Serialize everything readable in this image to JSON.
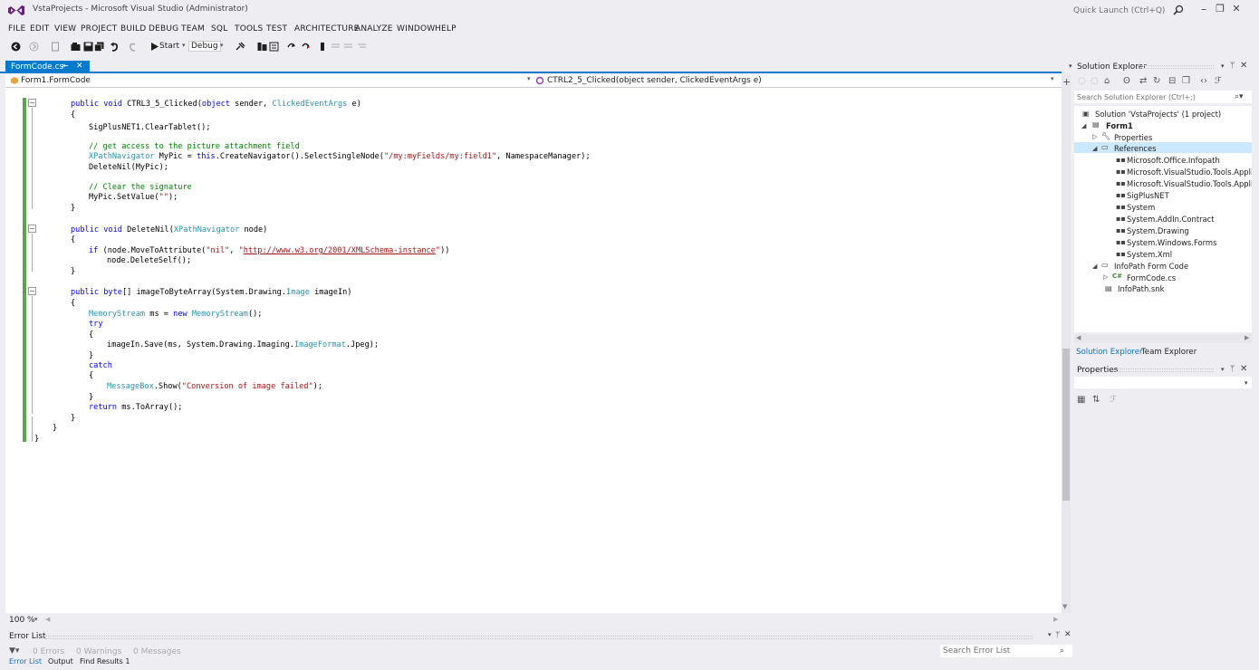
{
  "window": {
    "title": "VstaProjects - Microsoft Visual Studio (Administrator)",
    "quick_launch_placeholder": "Quick Launch (Ctrl+Q)",
    "minimize_glyph": "–",
    "maximize_glyph": "❐",
    "close_glyph": "✕"
  },
  "menu": [
    "FILE",
    "EDIT",
    "VIEW",
    "PROJECT",
    "BUILD",
    "DEBUG",
    "TEAM",
    "SQL",
    "TOOLS",
    "TEST",
    "ARCHITECTURE",
    "ANALYZE",
    "WINDOW",
    "HELP"
  ],
  "toolbar": {
    "start_label": "Start",
    "config_label": "Debug"
  },
  "editor": {
    "tab_label": "FormCode.cs",
    "pin_glyph": "⇤",
    "close_glyph": "✕",
    "nav_class": "Form1.FormCode",
    "nav_member": "CTRL2_5_Clicked(object sender, ClickedEventArgs e)",
    "zoom": "100 %"
  },
  "code_lines": [
    "public void CTRL3_5_Clicked(object sender, ClickedEventArgs e)",
    "{",
    "SigPlusNET1.ClearTablet();",
    "// get access to the picture attachment field",
    "XPathNavigator MyPic = this.CreateNavigator().SelectSingleNode(\"/my:myFields/my:field1\", NamespaceManager);",
    "DeleteNil(MyPic);",
    "// Clear the signature",
    "MyPic.SetValue(\"\");",
    "}",
    "public void DeleteNil(XPathNavigator node)",
    "{",
    "if (node.MoveToAttribute(\"nil\", \"http://www.w3.org/2001/XMLSchema-instance\"))",
    "node.DeleteSelf();",
    "}",
    "public byte[] imageToByteArray(System.Drawing.Image imageIn)",
    "{",
    "MemoryStream ms = new MemoryStream();",
    "try",
    "{",
    "imageIn.Save(ms, System.Drawing.Imaging.ImageFormat.Jpeg);",
    "}",
    "catch",
    "{",
    "MessageBox.Show(\"Conversion of image failed\");",
    "}",
    "return ms.ToArray();",
    "}",
    "}",
    "}"
  ],
  "code_tokens": {
    "kw_public": "public",
    "kw_void": "void",
    "kw_object": "object",
    "kw_this": "this",
    "kw_if": "if",
    "kw_byte": "byte",
    "kw_new": "new",
    "kw_try": "try",
    "kw_catch": "catch",
    "kw_return": "return",
    "t_clicked": "ClickedEventArgs",
    "t_xpath": "XPathNavigator",
    "t_image": "Image",
    "t_memstream": "MemoryStream",
    "t_imageformat": "ImageFormat",
    "t_messagebox": "MessageBox",
    "s_myfield": "\"/my:myFields/my:field1\"",
    "s_empty": "\"\"",
    "s_nil": "\"nil\"",
    "s_url": "http://www.w3.org/2001/XMLSchema-instance",
    "s_conv": "\"Conversion of image failed\"",
    "c_access": "// get access to the picture attachment field",
    "c_clear": "// Clear the signature",
    "p1a": "CTRL3_5_Clicked(",
    "p1b": " sender, ",
    "p1c": " e)",
    "p2": "SigPlusNET1.ClearTablet();",
    "p3a": " MyPic = ",
    "p3b": ".CreateNavigator().SelectSingleNode(",
    "p3c": ", NamespaceManager);",
    "p4": "DeleteNil(MyPic);",
    "p5a": "MyPic.SetValue(",
    "p5b": ");",
    "p6a": "DeleteNil(",
    "p6b": " node)",
    "p7a": " (node.MoveToAttribute(",
    "p7b": ", ",
    "p7q": "\"",
    "p7c": "))",
    "p8": "node.DeleteSelf();",
    "p9a": "[] imageToByteArray(System.Drawing.",
    "p9b": " imageIn)",
    "p10a": " ms = ",
    "p10b": "();",
    "p11a": "imageIn.Save(ms, System.Drawing.Imaging.",
    "p11b": ".Jpeg);",
    "p12a": ".Show(",
    "p12b": ");",
    "p13": " ms.ToArray();",
    "sp": " ",
    "brace_open": "{",
    "brace_close": "}"
  },
  "error_list": {
    "title": "Error List",
    "errors": "0 Errors",
    "warnings": "0 Warnings",
    "messages": "0 Messages",
    "search_placeholder": "Search Error List",
    "tabs": [
      "Error List",
      "Output",
      "Find Results 1"
    ]
  },
  "solution_explorer": {
    "title": "Solution Explorer",
    "search_placeholder": "Search Solution Explorer (Ctrl+;)",
    "tree": [
      {
        "label": "Solution 'VstaProjects' (1 project)"
      },
      {
        "label": "Form1"
      },
      {
        "label": "Properties"
      },
      {
        "label": "References"
      },
      {
        "label": "Microsoft.Office.Infopath"
      },
      {
        "label": "Microsoft.VisualStudio.Tools.Applic"
      },
      {
        "label": "Microsoft.VisualStudio.Tools.Applic"
      },
      {
        "label": "SigPlusNET"
      },
      {
        "label": "System"
      },
      {
        "label": "System.AddIn.Contract"
      },
      {
        "label": "System.Drawing"
      },
      {
        "label": "System.Windows.Forms"
      },
      {
        "label": "System.Xml"
      },
      {
        "label": "InfoPath Form Code"
      },
      {
        "label": "FormCode.cs"
      },
      {
        "label": "InfoPath.snk"
      }
    ],
    "tabs": [
      "Solution Explorer",
      "Team Explorer"
    ]
  },
  "properties": {
    "title": "Properties"
  },
  "colors": {
    "accent": "#007acc",
    "keyword": "#0000ff",
    "type": "#2b91af",
    "string": "#a31515",
    "comment": "#008000"
  }
}
